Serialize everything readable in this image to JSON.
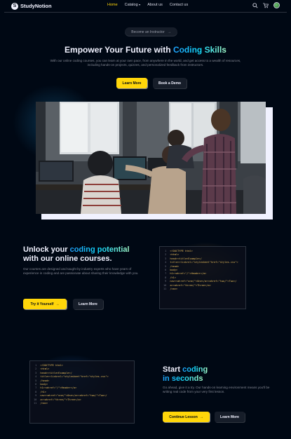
{
  "nav": {
    "logo_mark": "S",
    "logo_text": "StudyNotion",
    "links": [
      {
        "label": "Home",
        "active": true
      },
      {
        "label": "Catalog",
        "dropdown": true
      },
      {
        "label": "About us"
      },
      {
        "label": "Contact us"
      }
    ],
    "icons": [
      "search-icon",
      "cart-icon",
      "avatar"
    ]
  },
  "hero": {
    "pill_label": "Become an Instructor",
    "title_plain": "Empower Your Future with ",
    "title_highlight": "Coding Skills",
    "subtitle": "With our online coding courses, you can learn at your own pace, from anywhere in the world, and get access to a wealth of resources, including hands-on projects, quizzes, and personalized feedback from instructors.",
    "primary_button": "Learn More",
    "secondary_button": "Book a Demo"
  },
  "section1": {
    "title_plain_1": "Unlock your ",
    "title_highlight": "coding potential",
    "title_plain_2": "with our online courses.",
    "text": "Our courses are designed and taught by industry experts who have years of experience in coding and are passionate about sharing their knowledge with you.",
    "primary_button": "Try it Yourself",
    "secondary_button": "Learn More",
    "code_lines": [
      "<!DOCTYPE html>",
      "<html>",
      "head><title>Example</",
      "title><linkrel=\"stylesheet\"href=\"styles.css\">",
      "/head>",
      "body>",
      "h1><ahref=\"/\">Header</a>",
      "/h1>",
      "nav><ahref=\"one/\">One</a><ahref=\"two/\">Two</",
      "a><ahref=\"three/\">Three</a>",
      "/nav>"
    ]
  },
  "section2": {
    "title_plain": "Start ",
    "title_highlight_1": "coding",
    "title_highlight_2": "in seconds",
    "text": "Go ahead, give it a try. Our hands-on learning environment means you'll be writing real code from your very first lesson.",
    "primary_button": "Continue Lesson",
    "secondary_button": "Learn More",
    "code_lines": [
      "<!DOCTYPE html>",
      "<html>",
      "head><title>Example</",
      "title><linkrel=\"stylesheet\"href=\"styles.css\">",
      "/head>",
      "body>",
      "h1><ahref=\"/\">Header</a>",
      "/h1>",
      "nav><ahref=\"one/\">One</a><ahref=\"two/\">Two</",
      "a><ahref=\"three/\">Three</a>",
      "/nav>"
    ]
  },
  "colors": {
    "background": "#000814",
    "accent_yellow": "#ffd60a",
    "highlight_gradient": [
      "#1fa2ff",
      "#12d8fa",
      "#a6ffcb"
    ],
    "code_yellow": "#e7bc5b"
  }
}
